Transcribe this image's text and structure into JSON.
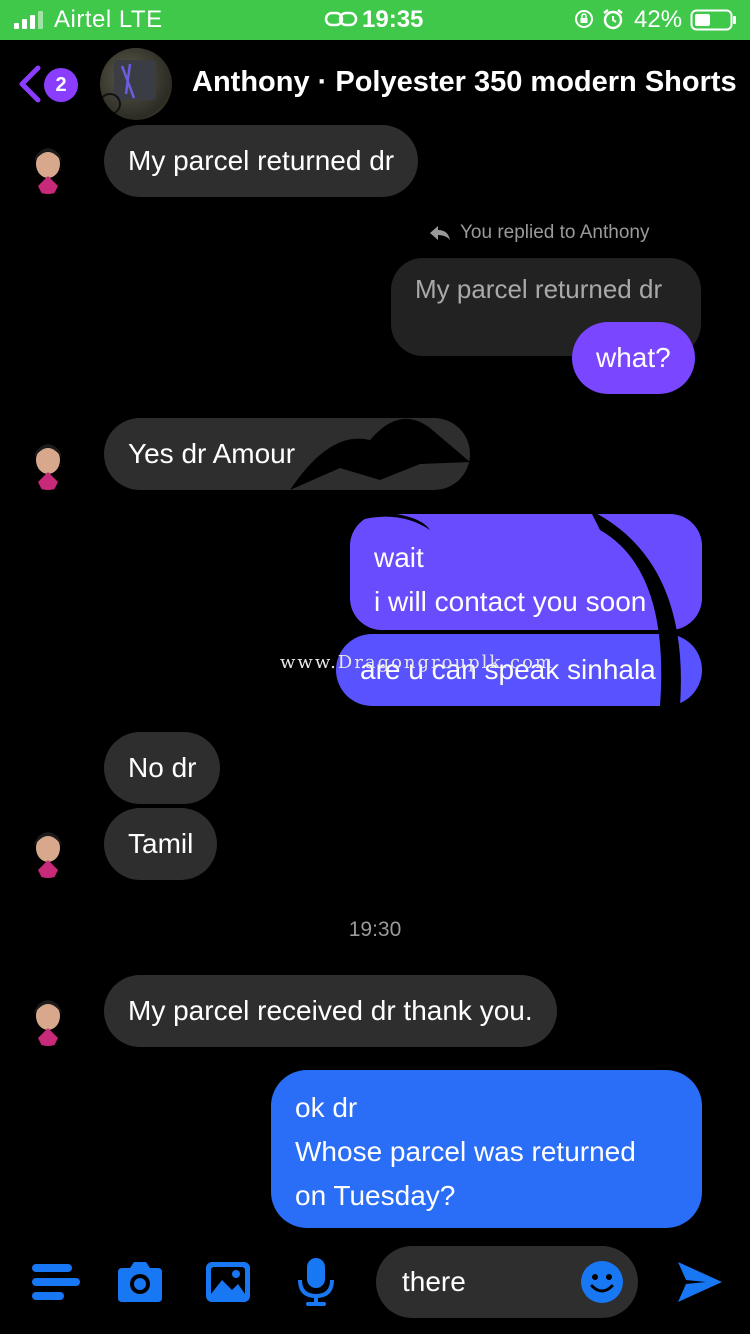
{
  "status_bar": {
    "carrier": "Airtel  LTE",
    "time": "19:35",
    "battery": "42%",
    "icons": [
      "signal-icon",
      "link-icon",
      "rotation-lock-icon",
      "alarm-icon",
      "battery-icon"
    ]
  },
  "header": {
    "back_icon": "chevron-left-icon",
    "unread_count": "2",
    "title": "Anthony · Polyester 350 modern Shorts"
  },
  "messages": {
    "m1": "My parcel returned dr",
    "reply_label": "You replied to Anthony",
    "reply_quote": "My parcel returned dr",
    "m2": "what?",
    "m3": "Yes dr Amour",
    "m4_line1": "wait",
    "m4_line2": "i will contact you soon",
    "m5": "are u can speak sinhala",
    "m6": "No dr",
    "m7": "Tamil",
    "timestamp": "19:30",
    "m8": "My parcel received dr thank you.",
    "m9_line1": "ok dr",
    "m9_line2": "Whose parcel was returned",
    "m9_line3": "on Tuesday?"
  },
  "watermark": "www.Dragongrouplk.com",
  "composer": {
    "input_value": "there",
    "icons": [
      "menu-icon",
      "camera-icon",
      "gallery-icon",
      "microphone-icon",
      "emoji-icon",
      "send-icon"
    ]
  },
  "colors": {
    "status_bar": "#3fc84a",
    "accent": "#8b3dff",
    "incoming_bubble": "#2e2e2e",
    "outgoing_purple": "#7a46ff",
    "outgoing_blue": "#2a6df6",
    "icon_blue": "#1877f2"
  }
}
